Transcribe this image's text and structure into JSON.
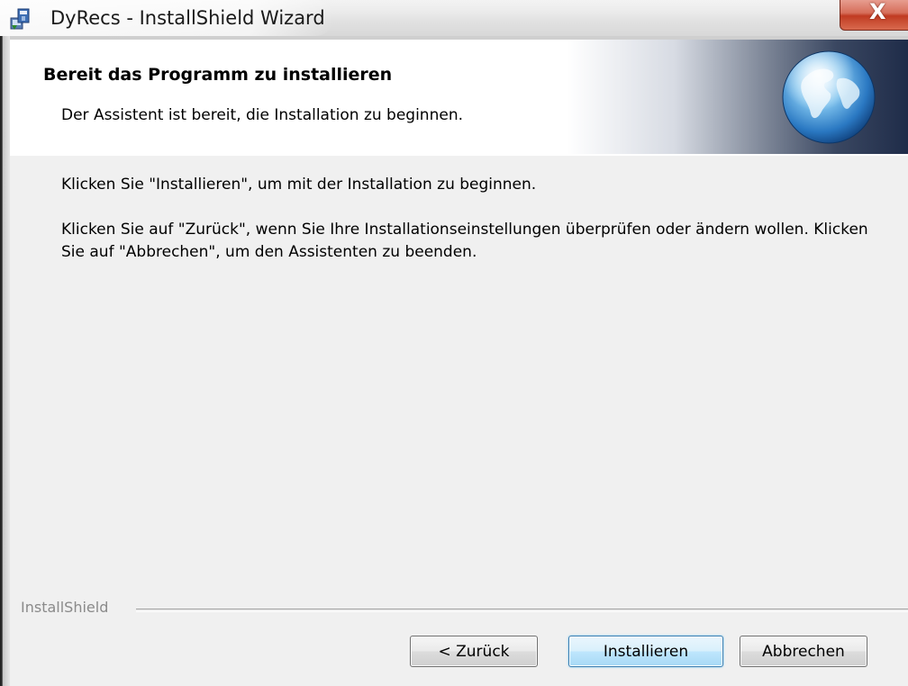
{
  "window": {
    "title": "DyRecs - InstallShield Wizard",
    "app_icon": "installer-icon",
    "close_glyph": "X"
  },
  "header": {
    "title": "Bereit das Programm zu installieren",
    "subtitle": "Der Assistent ist bereit, die Installation zu beginnen.",
    "image": "globe-icon"
  },
  "body": {
    "paragraph1": "Klicken Sie \"Installieren\", um mit der Installation zu beginnen.",
    "paragraph2": "Klicken Sie auf \"Zurück\", wenn Sie Ihre Installationseinstellungen überprüfen oder ändern wollen. Klicken Sie auf \"Abbrechen\", um den Assistenten zu beenden."
  },
  "footer": {
    "brand": "InstallShield",
    "buttons": {
      "back": "< Zurück",
      "install": "Installieren",
      "cancel": "Abbrechen"
    }
  },
  "colors": {
    "close_button": "#c94a31",
    "default_button_border": "#3c7fb1",
    "header_dark": "#1f2c49"
  }
}
